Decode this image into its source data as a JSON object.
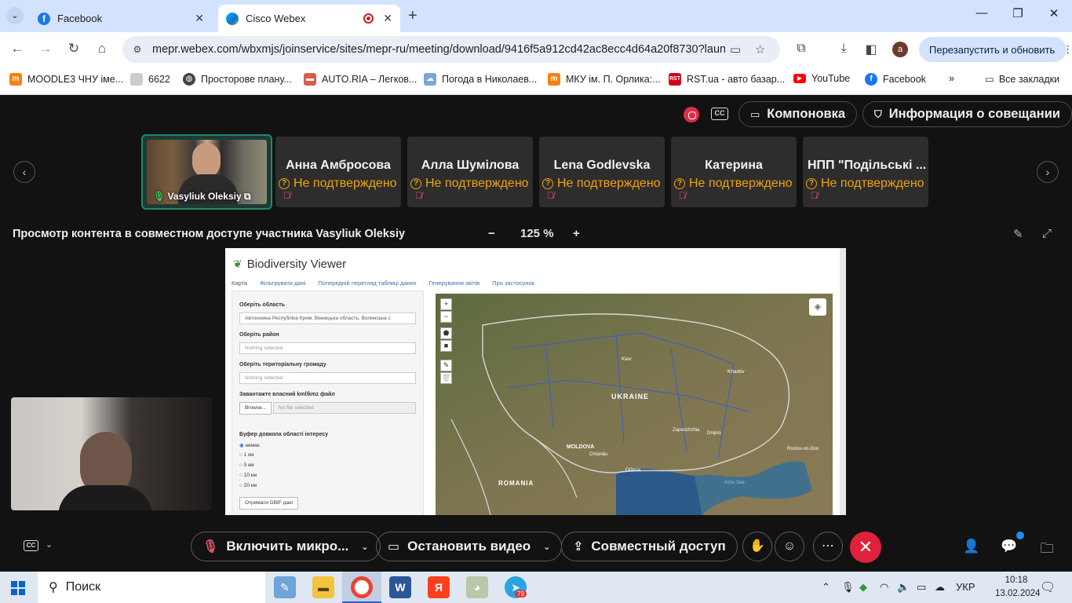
{
  "browser": {
    "tabs": [
      {
        "title": "Facebook",
        "favicon": "facebook-icon",
        "active": false
      },
      {
        "title": "Cisco Webex",
        "favicon": "webex-icon",
        "active": true,
        "recording": true
      }
    ],
    "url": "mepr.webex.com/wbxmjs/joinservice/sites/mepr-ru/meeting/download/9416f5a912cd42ac8ecc4d64a20f8730?launc...",
    "profile_initial": "a",
    "relaunch_label": "Перезапустить и обновить",
    "bookmarks": [
      {
        "label": "MOODLE3 ЧНУ імe...",
        "icon": "moodle-icon",
        "color": "#f98012"
      },
      {
        "label": "6622",
        "icon": "bookmark-icon",
        "color": "#888888"
      },
      {
        "label": "Просторове плану...",
        "icon": "globe-icon",
        "color": "#555555"
      },
      {
        "label": "AUTO.RIA – Легков...",
        "icon": "car-icon",
        "color": "#db5c4c"
      },
      {
        "label": "Погода в Николаев...",
        "icon": "weather-icon",
        "color": "#7aa6d8"
      },
      {
        "label": "МКУ ім. П. Орлика:...",
        "icon": "moodle-icon",
        "color": "#f98012"
      },
      {
        "label": "RST.ua - авто базар...",
        "icon": "rst-icon",
        "color": "#d2001a"
      },
      {
        "label": "YouTube",
        "icon": "youtube-icon",
        "color": "#ff0000"
      },
      {
        "label": "Facebook",
        "icon": "facebook-icon",
        "color": "#1877f2"
      }
    ],
    "all_bookmarks": "Все закладки"
  },
  "meeting": {
    "layout_label": "Компоновка",
    "info_label": "Информация о совещании",
    "self": {
      "name": "Vasyliuk Oleksiy"
    },
    "participants": [
      {
        "name": "Анна Амбросова",
        "status": "Не подтверждено"
      },
      {
        "name": "Алла Шумілова",
        "status": "Не подтверждено"
      },
      {
        "name": "Lena Godlevska",
        "status": "Не подтверждено"
      },
      {
        "name": "Катерина",
        "status": "Не подтверждено"
      },
      {
        "name": "НПП \"Подільські ...",
        "status": "Не подтверждено"
      }
    ],
    "share_title": "Просмотр контента в совместном доступе участника Vasyliuk Oleksiy",
    "zoom": "125 %",
    "controls": {
      "mic": "Включить микро...",
      "video": "Остановить видео",
      "share": "Совместный доступ"
    },
    "colors": {
      "hangup": "#e0213b",
      "warning": "#f0a30a",
      "self_border": "#1d8a6b"
    }
  },
  "shared_app": {
    "title": "Biodiversity Viewer",
    "tabs": [
      "Карта",
      "Фільтрувати дані",
      "Попередній перегляд таблиці даних",
      "Генерування звітів",
      "Про застосунок"
    ],
    "region_label": "Оберіть область",
    "region_value": "Автономна Республіка Крим, Вінницька область, Волинська с",
    "district_label": "Оберіть район",
    "district_placeholder": "Nothing selected",
    "community_label": "Оберіть територіальну громаду",
    "community_placeholder": "Nothing selected",
    "upload_label": "Завантажте власний kml/kmz файл",
    "browse_label": "Browse...",
    "no_file": "No file selected",
    "buffer_label": "Буфер довкола області інтересу",
    "buffer_options": [
      "немає",
      "1 км",
      "5 км",
      "10 км",
      "20 км"
    ],
    "gbif_button": "Отримати GBIF дані",
    "map_labels": {
      "ukraine": "UKRAINE",
      "moldova": "MOLDOVA",
      "romania": "ROMANIA",
      "kyiv": "Kiev",
      "odesa": "Odesa",
      "chisinau": "Chișinău",
      "kharkiv": "Kharkiv",
      "dnipro": "Dnipro",
      "rostov": "Rostov-on-Don",
      "zaporizhzhia": "Zaporizhzhia",
      "sea": "Azov Sea"
    }
  },
  "taskbar": {
    "search": "Поиск",
    "lang": "УКР",
    "time": "10:18",
    "date": "13.02.2024",
    "telegram_badge": "79"
  }
}
